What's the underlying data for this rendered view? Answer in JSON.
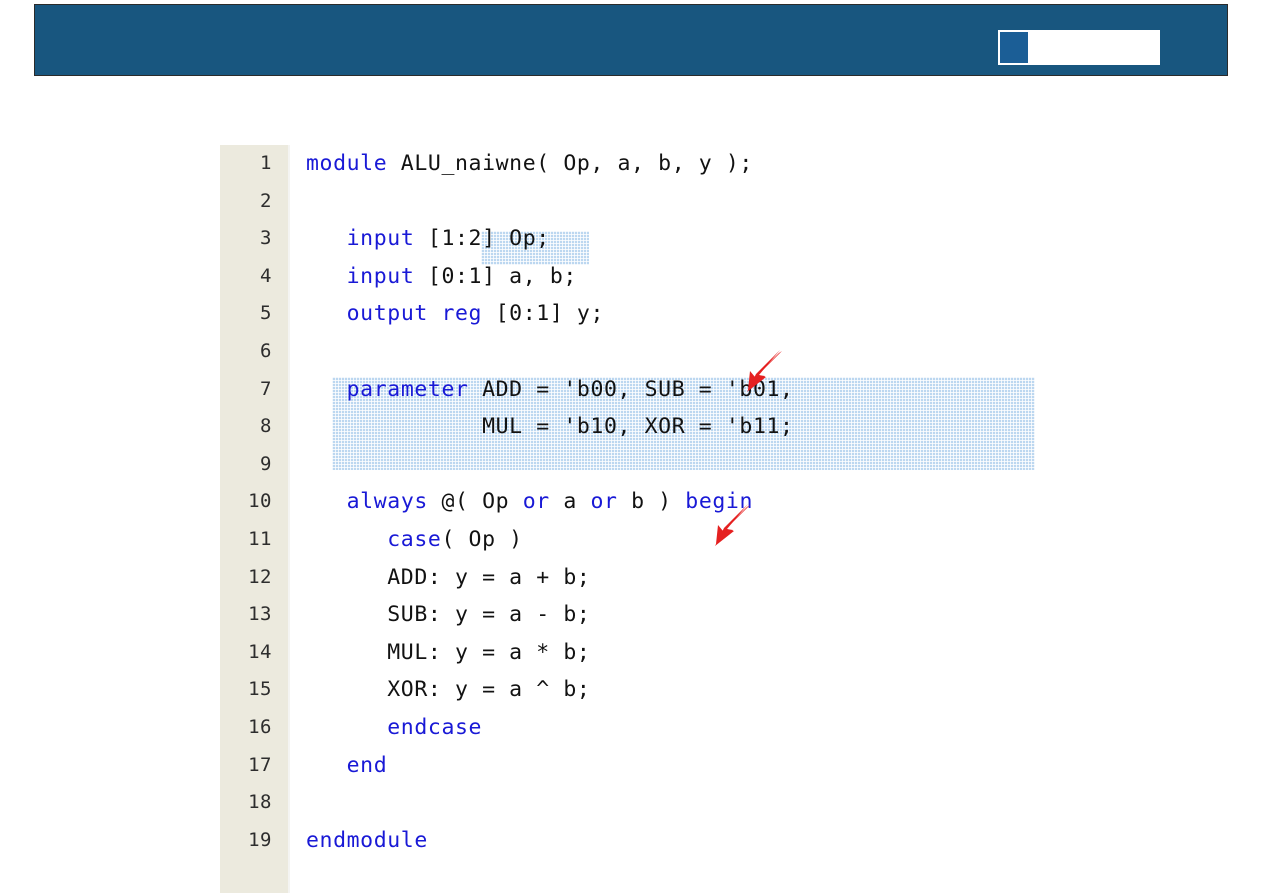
{
  "header": {
    "banner_color": "#18567f",
    "title_box": {
      "marker_color": "#1b5e96",
      "text": ""
    }
  },
  "editor": {
    "gutter_color": "#eceade",
    "background_color": "#ffffff",
    "keyword_color": "#1919d6",
    "text_color": "#121212",
    "selection_color": "#bcd7f0",
    "language": "Verilog",
    "total_lines": 19,
    "lines": [
      {
        "num": "1",
        "indent": 0,
        "segments": [
          {
            "t": "module",
            "k": true
          },
          {
            "t": " ALU_naiwne( Op, a, b, y );",
            "k": false
          }
        ]
      },
      {
        "num": "2",
        "indent": 0,
        "segments": [
          {
            "t": "",
            "k": false
          }
        ]
      },
      {
        "num": "3",
        "indent": 0,
        "segments": [
          {
            "t": "   ",
            "k": false
          },
          {
            "t": "input",
            "k": true
          },
          {
            "t": " [1:2] Op;",
            "k": false
          }
        ]
      },
      {
        "num": "4",
        "indent": 0,
        "segments": [
          {
            "t": "   ",
            "k": false
          },
          {
            "t": "input",
            "k": true
          },
          {
            "t": " [0:1] a, b;",
            "k": false
          }
        ]
      },
      {
        "num": "5",
        "indent": 0,
        "segments": [
          {
            "t": "   ",
            "k": false
          },
          {
            "t": "output reg",
            "k": true
          },
          {
            "t": " [0:1] y;",
            "k": false
          }
        ]
      },
      {
        "num": "6",
        "indent": 0,
        "segments": [
          {
            "t": "",
            "k": false
          }
        ]
      },
      {
        "num": "7",
        "indent": 0,
        "segments": [
          {
            "t": "   ",
            "k": false
          },
          {
            "t": "parameter",
            "k": true
          },
          {
            "t": " ADD = 'b00, SUB = 'b01,",
            "k": false
          }
        ]
      },
      {
        "num": "8",
        "indent": 0,
        "segments": [
          {
            "t": "             MUL = 'b10, XOR = 'b11;",
            "k": false
          }
        ]
      },
      {
        "num": "9",
        "indent": 0,
        "segments": [
          {
            "t": "",
            "k": false
          }
        ]
      },
      {
        "num": "10",
        "indent": 0,
        "segments": [
          {
            "t": "   ",
            "k": false
          },
          {
            "t": "always",
            "k": true
          },
          {
            "t": " @( Op ",
            "k": false
          },
          {
            "t": "or",
            "k": true
          },
          {
            "t": " a ",
            "k": false
          },
          {
            "t": "or",
            "k": true
          },
          {
            "t": " b ) ",
            "k": false
          },
          {
            "t": "begin",
            "k": true
          }
        ]
      },
      {
        "num": "11",
        "indent": 0,
        "segments": [
          {
            "t": "      ",
            "k": false
          },
          {
            "t": "case",
            "k": true
          },
          {
            "t": "( Op )",
            "k": false
          }
        ]
      },
      {
        "num": "12",
        "indent": 0,
        "segments": [
          {
            "t": "      ADD: y = a + b;",
            "k": false
          }
        ]
      },
      {
        "num": "13",
        "indent": 0,
        "segments": [
          {
            "t": "      SUB: y = a - b;",
            "k": false
          }
        ]
      },
      {
        "num": "14",
        "indent": 0,
        "segments": [
          {
            "t": "      MUL: y = a * b;",
            "k": false
          }
        ]
      },
      {
        "num": "15",
        "indent": 0,
        "segments": [
          {
            "t": "      XOR: y = a ^ b;",
            "k": false
          }
        ]
      },
      {
        "num": "16",
        "indent": 0,
        "segments": [
          {
            "t": "      ",
            "k": false
          },
          {
            "t": "endcase",
            "k": true
          }
        ]
      },
      {
        "num": "17",
        "indent": 0,
        "segments": [
          {
            "t": "   ",
            "k": false
          },
          {
            "t": "end",
            "k": true
          }
        ]
      },
      {
        "num": "18",
        "indent": 0,
        "segments": [
          {
            "t": "",
            "k": false
          }
        ]
      },
      {
        "num": "19",
        "indent": 0,
        "segments": [
          {
            "t": "endmodule",
            "k": true
          }
        ]
      }
    ],
    "selections": [
      {
        "name": "port-width-selection",
        "target_text": "[1:2]",
        "line": "3"
      },
      {
        "name": "parameter-block-selection",
        "target_text": "parameter ADD = 'b00, SUB = 'b01, MUL = 'b10, XOR = 'b11;",
        "lines": "7-8"
      }
    ],
    "annotations": [
      {
        "name": "arrow-port-width",
        "color": "#e52020",
        "points_to": "[1:2]"
      },
      {
        "name": "arrow-parameter",
        "color": "#e52020",
        "points_to": "parameter"
      }
    ]
  }
}
